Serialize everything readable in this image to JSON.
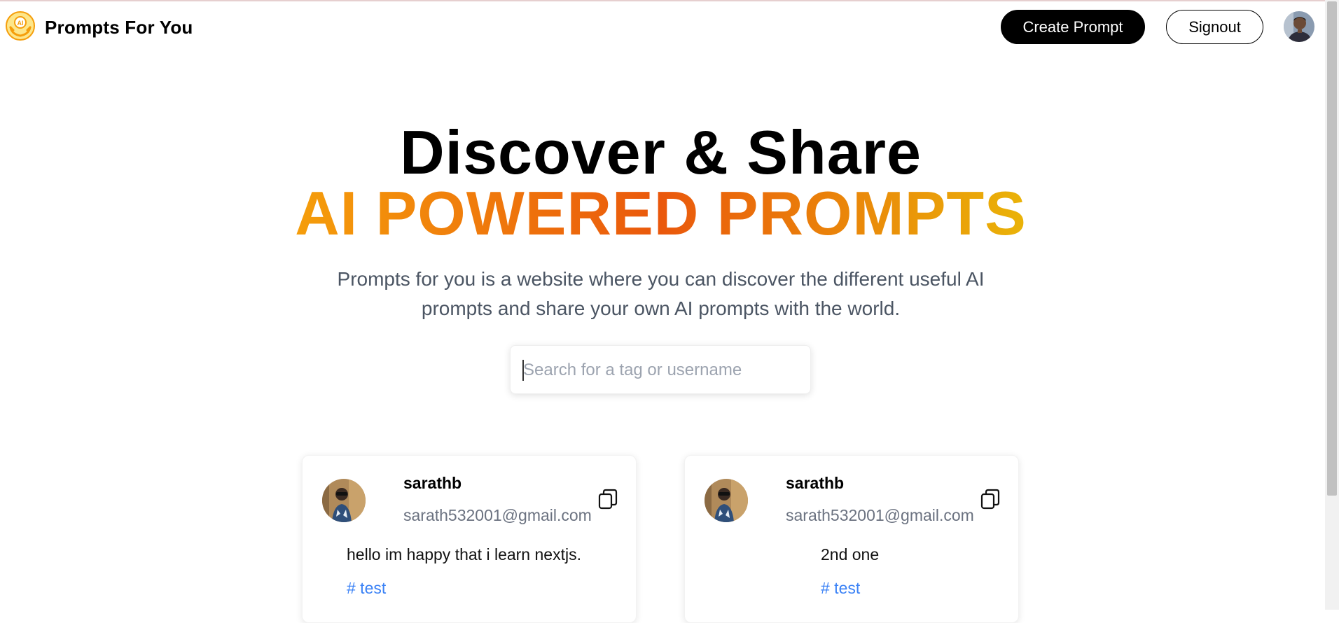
{
  "nav": {
    "brand": "Prompts For You",
    "create_label": "Create Prompt",
    "signout_label": "Signout",
    "logo_icon": "hands-ai-logo",
    "avatar_icon": "user-avatar"
  },
  "hero": {
    "title": "Discover & Share",
    "subtitle": "AI POWERED PROMPTS",
    "description": "Prompts for you is a website where you can discover the different useful AI prompts and share your own AI prompts with the world.",
    "gradient_colors": [
      "#f59e0b",
      "#ea580c",
      "#eab308"
    ]
  },
  "search": {
    "placeholder": "Search for a tag or username",
    "value": ""
  },
  "prompts": [
    {
      "username": "sarathb",
      "email": "sarath532001@gmail.com",
      "text": "hello im happy that i learn nextjs.",
      "tag": "# test"
    },
    {
      "username": "sarathb",
      "email": "sarath532001@gmail.com",
      "text": "2nd one",
      "tag": "# test"
    }
  ],
  "colors": {
    "accent_orange": "#ea580c",
    "tag_blue": "#3b82f6",
    "description_gray": "#4b5563"
  }
}
